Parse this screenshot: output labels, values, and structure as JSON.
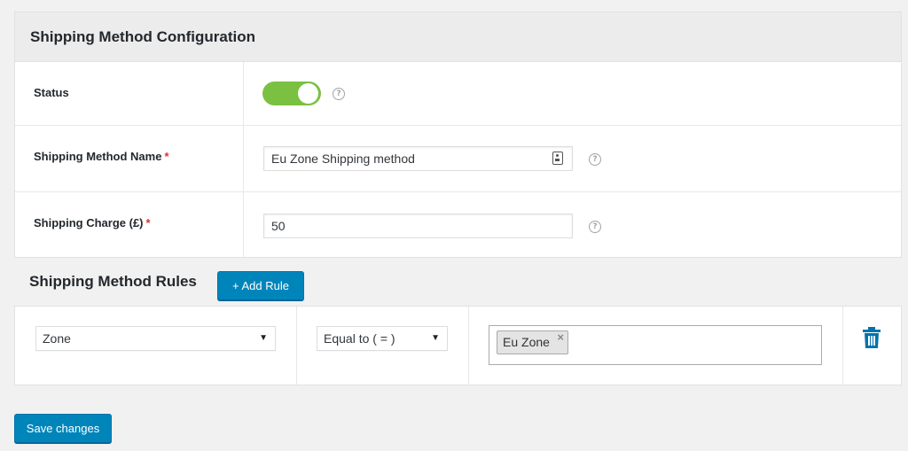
{
  "config": {
    "title": "Shipping Method Configuration",
    "status_label": "Status",
    "status_enabled": true,
    "name_label": "Shipping Method Name",
    "name_value": "Eu Zone Shipping method",
    "charge_label": "Shipping Charge (£)",
    "charge_value": "50",
    "required_mark": "*",
    "help_glyph": "?"
  },
  "rules": {
    "title": "Shipping Method Rules",
    "add_button": "+ Add Rule",
    "rule_items": [
      {
        "condition": "Zone",
        "operator": "Equal to ( = )",
        "values": [
          "Eu Zone"
        ]
      }
    ],
    "remove_glyph": "×",
    "dropdown_glyph": "▼"
  },
  "footer": {
    "save_button": "Save changes"
  },
  "colors": {
    "accent": "#0085ba",
    "toggle_on": "#7ac142",
    "required": "#dc3232",
    "trash": "#0073aa"
  }
}
